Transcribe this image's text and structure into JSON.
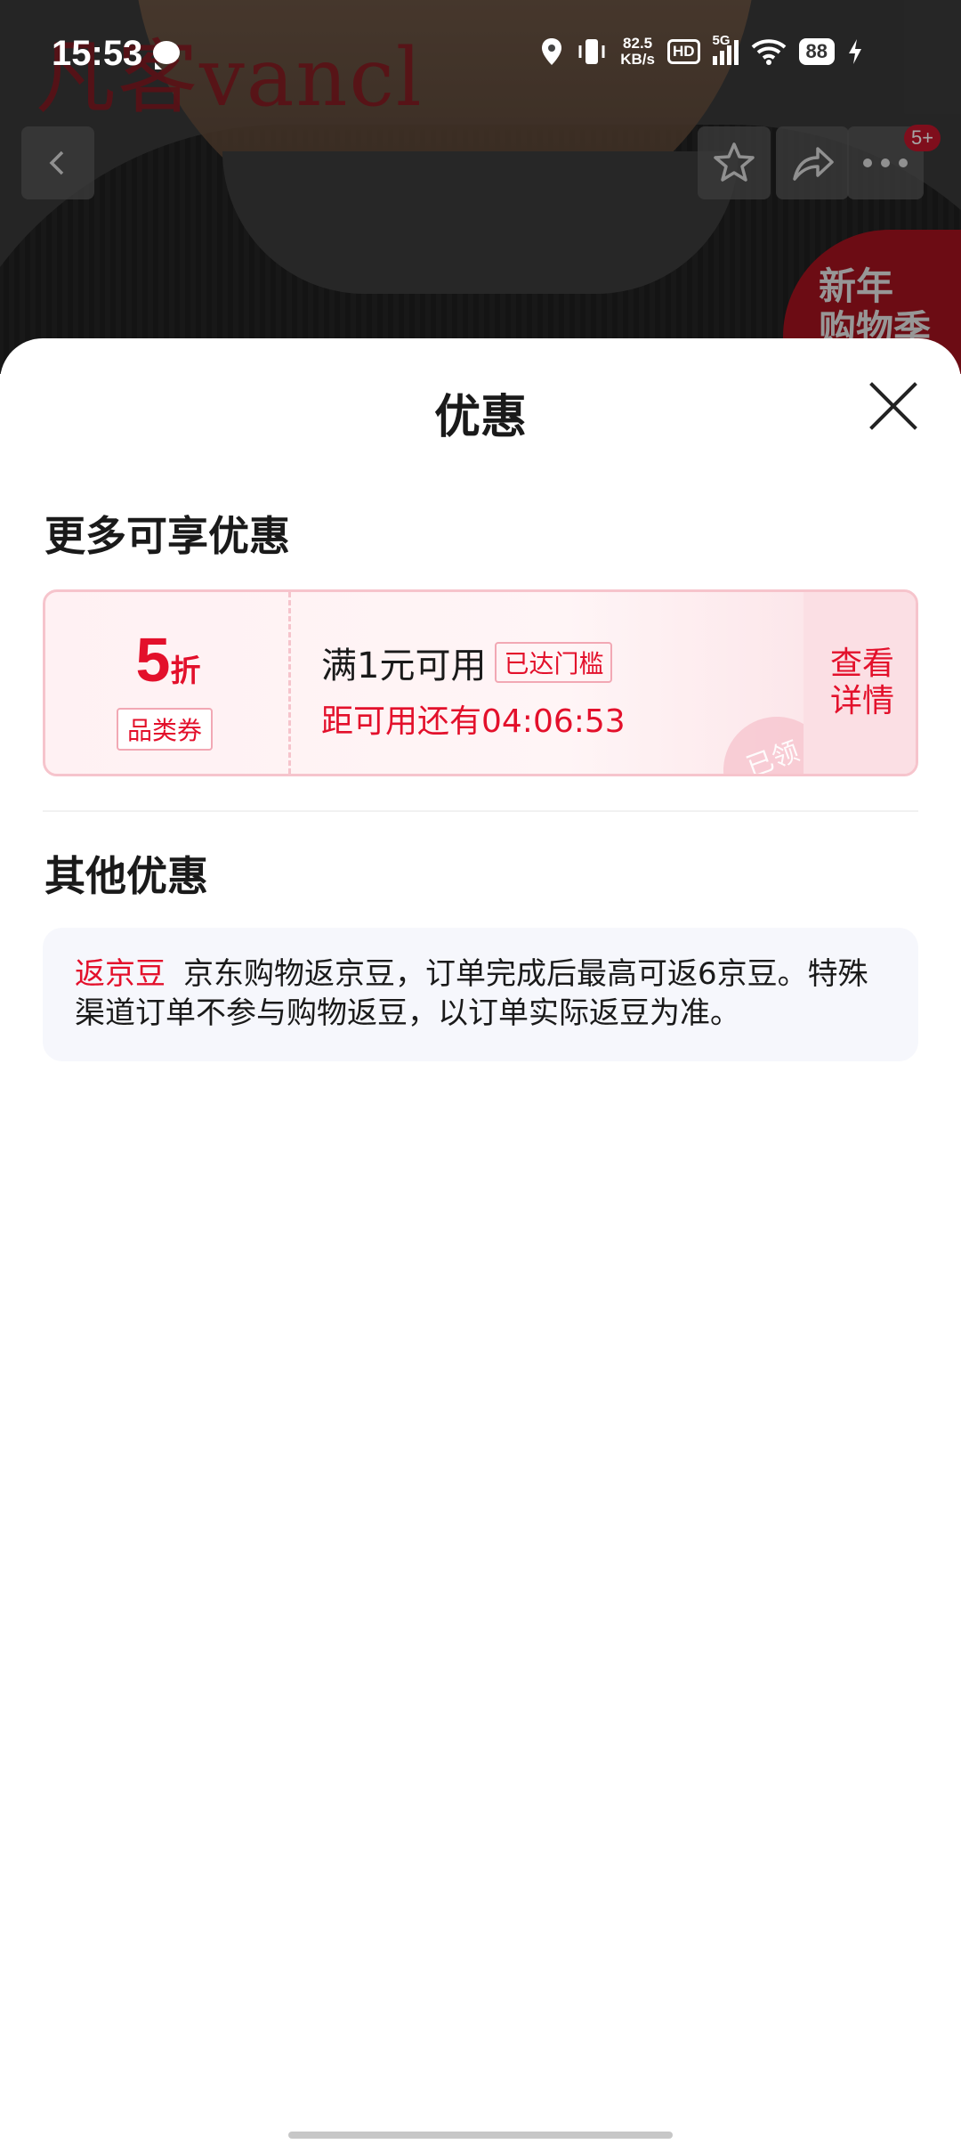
{
  "status_bar": {
    "time": "15:53",
    "net_speed": "82.5",
    "net_unit": "KB/s",
    "hd": "HD",
    "network": "5G",
    "battery": "88"
  },
  "product_bg": {
    "brand": "凡客vancl",
    "promo_line1": "新年",
    "promo_line2": "购物季",
    "message_count": "5+"
  },
  "sheet": {
    "title": "优惠",
    "more_heading": "更多可享优惠",
    "coupon": {
      "discount_value": "5",
      "discount_unit": "折",
      "category_tag": "品类券",
      "condition": "满1元可用",
      "reached_tag": "已达门槛",
      "countdown": "距可用还有04:06:53",
      "detail_line1": "查看",
      "detail_line2": "详情",
      "claimed_stamp": "已领"
    },
    "other_heading": "其他优惠",
    "bean": {
      "tag": "返京豆",
      "text": "京东购物返京豆，订单完成后最高可返6京豆。特殊渠道订单不参与购物返豆，以订单实际返豆为准。"
    }
  }
}
